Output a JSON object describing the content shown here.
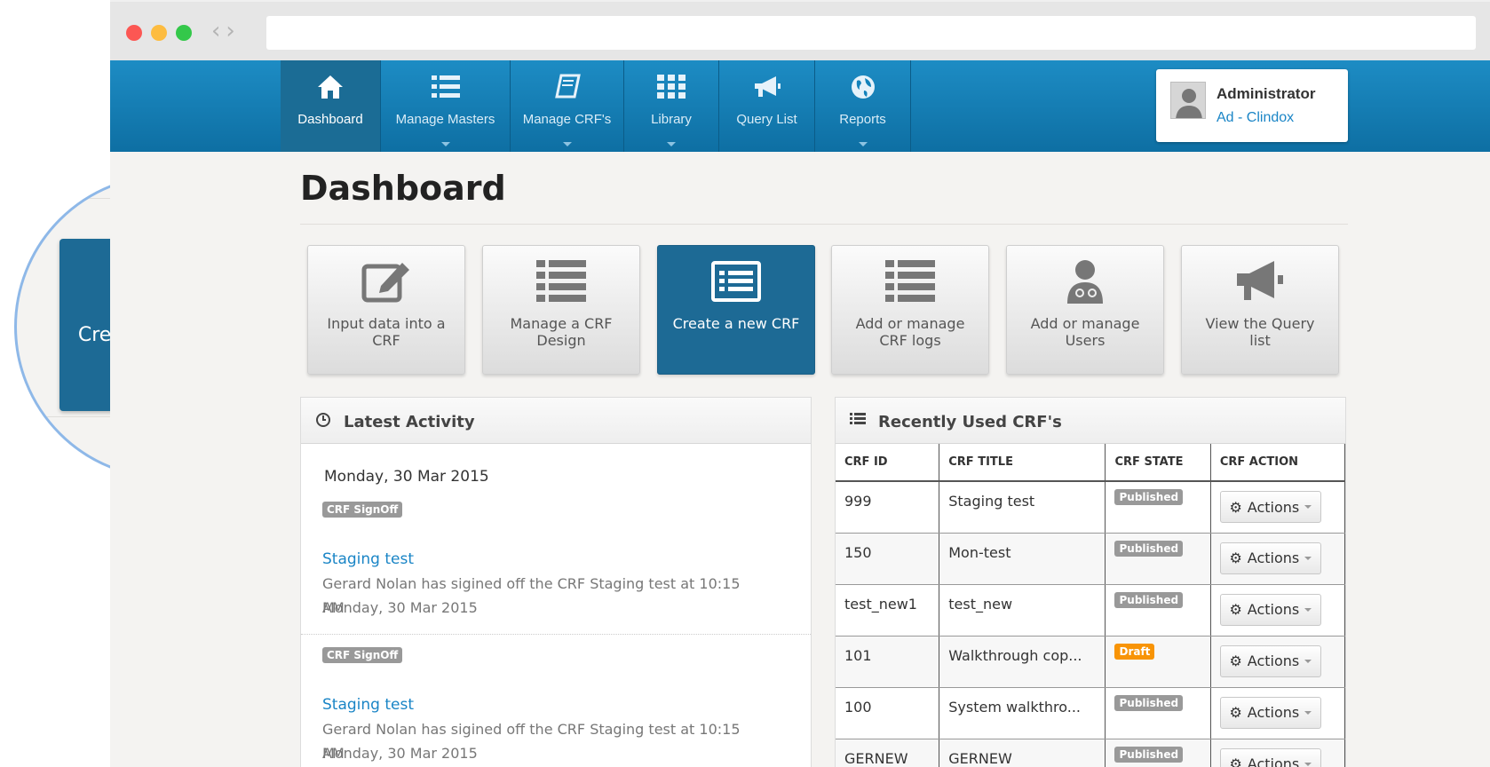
{
  "nav": {
    "items": [
      {
        "label": "Dashboard",
        "icon": "home-icon",
        "active": true
      },
      {
        "label": "Manage Masters",
        "icon": "list-icon"
      },
      {
        "label": "Manage CRF's",
        "icon": "book-icon"
      },
      {
        "label": "Library",
        "icon": "grid-icon"
      },
      {
        "label": "Query List",
        "icon": "megaphone-icon"
      },
      {
        "label": "Reports",
        "icon": "globe-icon"
      }
    ]
  },
  "user": {
    "name": "Administrator",
    "org": "Ad - Clindox"
  },
  "page": {
    "title": "Dashboard"
  },
  "tiles": [
    {
      "label": "Input data into a CRF",
      "icon": "edit-icon"
    },
    {
      "label": "Manage a CRF Design",
      "icon": "list-icon"
    },
    {
      "label": "Create a new CRF",
      "icon": "form-icon",
      "active": true
    },
    {
      "label": "Add or manage CRF logs",
      "icon": "list-icon"
    },
    {
      "label": "Add or manage Users",
      "icon": "user-doctor-icon"
    },
    {
      "label": "View the Query list",
      "icon": "megaphone-icon"
    }
  ],
  "activity": {
    "title": "Latest Activity",
    "date": "Monday, 30 Mar 2015",
    "entries": [
      {
        "badge": "CRF SignOff",
        "link": "Staging test",
        "text": "Gerard Nolan has sigined off the CRF Staging test at 10:15 AM",
        "time": "Monday, 30 Mar 2015"
      },
      {
        "badge": "CRF SignOff",
        "link": "Staging test",
        "text": "Gerard Nolan has sigined off the CRF Staging test at 10:15 AM",
        "time": "Monday, 30 Mar 2015"
      }
    ]
  },
  "recent": {
    "title": "Recently Used CRF's",
    "columns": [
      "CRF ID",
      "CRF TITLE",
      "CRF STATE",
      "CRF ACTION"
    ],
    "action_label": "Actions",
    "rows": [
      {
        "id": "999",
        "title": "Staging test",
        "state": "Published"
      },
      {
        "id": "150",
        "title": "Mon-test",
        "state": "Published"
      },
      {
        "id": "test_new1",
        "title": "test_new",
        "state": "Published"
      },
      {
        "id": "101",
        "title": "Walkthrough cop...",
        "state": "Draft"
      },
      {
        "id": "100",
        "title": "System walkthro...",
        "state": "Published"
      },
      {
        "id": "GERNEW",
        "title": "GERNEW",
        "state": "Published"
      }
    ]
  },
  "zoom": {
    "label": "Create a new CRF"
  },
  "colors": {
    "nav": "#1d8cc4",
    "tile_active": "#1d6a95",
    "link": "#1a85c6",
    "draft": "#f89406",
    "published": "#999999"
  }
}
